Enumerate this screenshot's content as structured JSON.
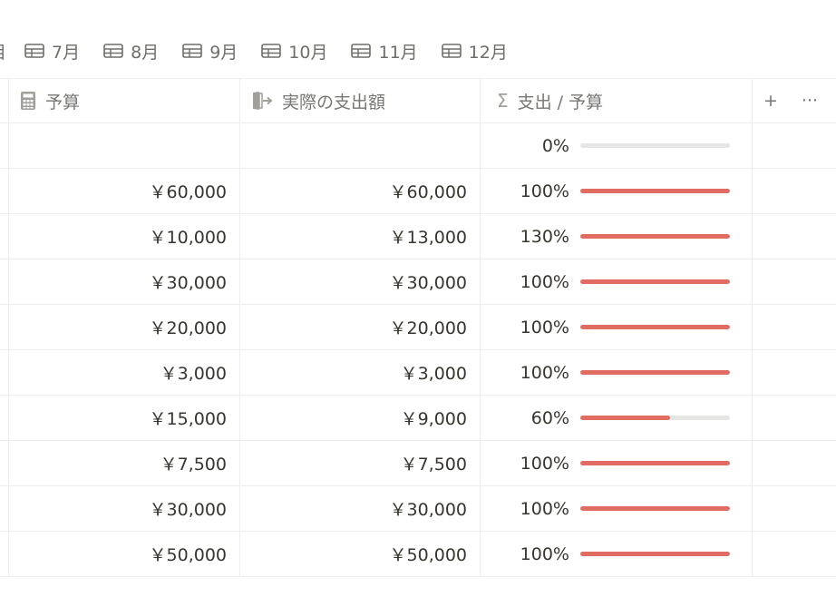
{
  "tabs": [
    {
      "label": ""
    },
    {
      "label": "7月"
    },
    {
      "label": "8月"
    },
    {
      "label": "9月"
    },
    {
      "label": "10月"
    },
    {
      "label": "11月"
    },
    {
      "label": "12月"
    }
  ],
  "columns": {
    "budget": "予算",
    "actual": "実際の支出額",
    "ratio": "支出 / 予算"
  },
  "header_actions": {
    "add": "+",
    "more": "···"
  },
  "colors": {
    "bar_fill": "#e06c62",
    "bar_track": "#e6e6e4"
  },
  "rows": [
    {
      "budget": "",
      "actual": "",
      "percent_label": "0%",
      "percent": 0
    },
    {
      "budget": "￥60,000",
      "actual": "￥60,000",
      "percent_label": "100%",
      "percent": 100
    },
    {
      "budget": "￥10,000",
      "actual": "￥13,000",
      "percent_label": "130%",
      "percent": 130
    },
    {
      "budget": "￥30,000",
      "actual": "￥30,000",
      "percent_label": "100%",
      "percent": 100
    },
    {
      "budget": "￥20,000",
      "actual": "￥20,000",
      "percent_label": "100%",
      "percent": 100
    },
    {
      "budget": "￥3,000",
      "actual": "￥3,000",
      "percent_label": "100%",
      "percent": 100
    },
    {
      "budget": "￥15,000",
      "actual": "￥9,000",
      "percent_label": "60%",
      "percent": 60
    },
    {
      "budget": "￥7,500",
      "actual": "￥7,500",
      "percent_label": "100%",
      "percent": 100
    },
    {
      "budget": "￥30,000",
      "actual": "￥30,000",
      "percent_label": "100%",
      "percent": 100
    },
    {
      "budget": "￥50,000",
      "actual": "￥50,000",
      "percent_label": "100%",
      "percent": 100
    }
  ]
}
